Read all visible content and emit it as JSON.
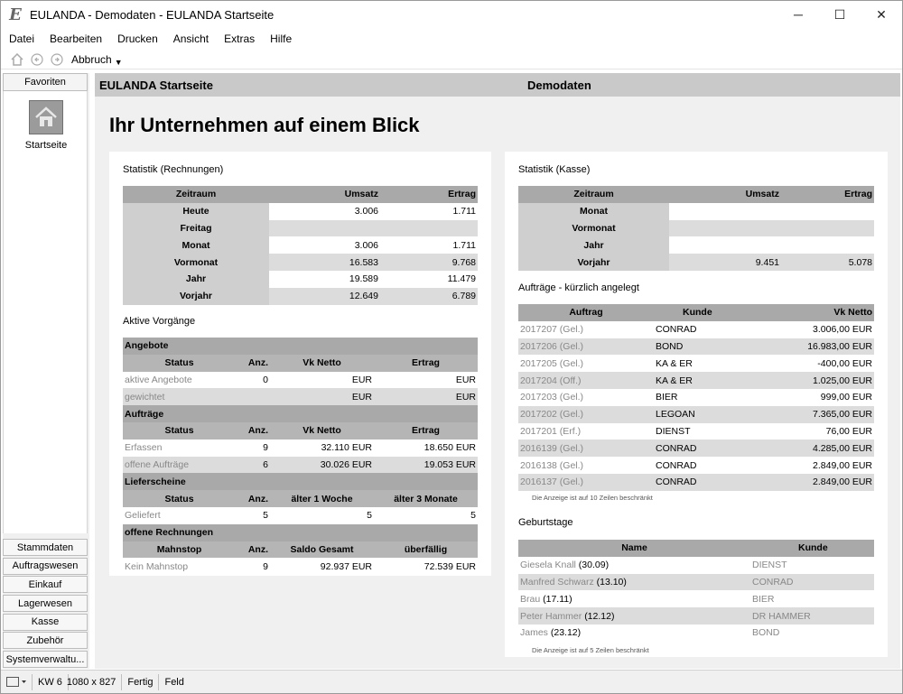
{
  "window": {
    "title": "EULANDA - Demodaten - EULANDA Startseite",
    "icon": "E",
    "controls": [
      "─",
      "☐",
      "✕"
    ]
  },
  "menu": [
    "Datei",
    "Bearbeiten",
    "Drucken",
    "Ansicht",
    "Extras",
    "Hilfe"
  ],
  "toolbar": {
    "abort_label": "Abbruch"
  },
  "sidebar": {
    "favorites_header": "Favoriten",
    "tile_label": "Startseite",
    "nav": [
      "Stammdaten",
      "Auftragswesen",
      "Einkauf",
      "Lagerwesen",
      "Kasse",
      "Zubehör",
      "Systemverwaltu..."
    ]
  },
  "main": {
    "header_left": "EULANDA Startseite",
    "header_center": "Demodaten",
    "headline": "Ihr Unternehmen auf einem Blick"
  },
  "stats_invoices": {
    "title": "Statistik (Rechnungen)",
    "columns": [
      "Zeitraum",
      "Umsatz",
      "Ertrag"
    ],
    "rows": [
      {
        "label": "Heute",
        "umsatz": "3.006",
        "ertrag": "1.711"
      },
      {
        "label": "Freitag",
        "umsatz": "",
        "ertrag": ""
      },
      {
        "label": "Monat",
        "umsatz": "3.006",
        "ertrag": "1.711"
      },
      {
        "label": "Vormonat",
        "umsatz": "16.583",
        "ertrag": "9.768"
      },
      {
        "label": "Jahr",
        "umsatz": "19.589",
        "ertrag": "11.479"
      },
      {
        "label": "Vorjahr",
        "umsatz": "12.649",
        "ertrag": "6.789"
      }
    ]
  },
  "active": {
    "title": "Aktive Vorgänge",
    "angebote": {
      "band": "Angebote",
      "columns": [
        "Status",
        "Anz.",
        "Vk Netto",
        "Ertrag"
      ],
      "rows": [
        {
          "status": "aktive Angebote",
          "anz": "0",
          "vk": "EUR",
          "ertrag": "EUR"
        },
        {
          "status": "gewichtet",
          "anz": "",
          "vk": "EUR",
          "ertrag": "EUR"
        }
      ]
    },
    "auftraege": {
      "band": "Aufträge",
      "columns": [
        "Status",
        "Anz.",
        "Vk Netto",
        "Ertrag"
      ],
      "rows": [
        {
          "status": "Erfassen",
          "anz": "9",
          "vk": "32.110 EUR",
          "ertrag": "18.650 EUR"
        },
        {
          "status": "offene Aufträge",
          "anz": "6",
          "vk": "30.026 EUR",
          "ertrag": "19.053 EUR"
        }
      ]
    },
    "lieferscheine": {
      "band": "Lieferscheine",
      "columns": [
        "Status",
        "Anz.",
        "älter 1 Woche",
        "älter 3 Monate"
      ],
      "rows": [
        {
          "status": "Geliefert",
          "anz": "5",
          "vk": "5",
          "ertrag": "5"
        }
      ]
    },
    "rechnungen": {
      "band": "offene Rechnungen",
      "columns": [
        "Mahnstop",
        "Anz.",
        "Saldo Gesamt",
        "überfällig"
      ],
      "rows": [
        {
          "status": "Kein Mahnstop",
          "anz": "9",
          "vk": "92.937 EUR",
          "ertrag": "72.539 EUR"
        }
      ]
    }
  },
  "stats_cash": {
    "title": "Statistik (Kasse)",
    "columns": [
      "Zeitraum",
      "Umsatz",
      "Ertrag"
    ],
    "rows": [
      {
        "label": "Monat",
        "umsatz": "",
        "ertrag": ""
      },
      {
        "label": "Vormonat",
        "umsatz": "",
        "ertrag": ""
      },
      {
        "label": "Jahr",
        "umsatz": "",
        "ertrag": ""
      },
      {
        "label": "Vorjahr",
        "umsatz": "9.451",
        "ertrag": "5.078"
      }
    ]
  },
  "orders": {
    "title": "Aufträge - kürzlich angelegt",
    "columns": [
      "Auftrag",
      "Kunde",
      "Vk Netto"
    ],
    "rows": [
      {
        "auftrag": "2017207 (Gel.)",
        "kunde": "CONRAD",
        "vk": "3.006,00 EUR"
      },
      {
        "auftrag": "2017206 (Gel.)",
        "kunde": "BOND",
        "vk": "16.983,00 EUR"
      },
      {
        "auftrag": "2017205 (Gel.)",
        "kunde": "KA & ER",
        "vk": "-400,00 EUR"
      },
      {
        "auftrag": "2017204 (Off.)",
        "kunde": "KA & ER",
        "vk": "1.025,00 EUR"
      },
      {
        "auftrag": "2017203 (Gel.)",
        "kunde": "BIER",
        "vk": "999,00 EUR"
      },
      {
        "auftrag": "2017202 (Gel.)",
        "kunde": "LEGOAN",
        "vk": "7.365,00 EUR"
      },
      {
        "auftrag": "2017201 (Erf.)",
        "kunde": "DIENST",
        "vk": "76,00 EUR"
      },
      {
        "auftrag": "2016139 (Gel.)",
        "kunde": "CONRAD",
        "vk": "4.285,00 EUR"
      },
      {
        "auftrag": "2016138 (Gel.)",
        "kunde": "CONRAD",
        "vk": "2.849,00 EUR"
      },
      {
        "auftrag": "2016137 (Gel.)",
        "kunde": "CONRAD",
        "vk": "2.849,00 EUR"
      }
    ],
    "note": "Die Anzeige ist auf 10 Zeilen beschränkt"
  },
  "birthdays": {
    "title": "Geburtstage",
    "columns": [
      "Name",
      "Kunde"
    ],
    "rows": [
      {
        "name": "Giesela Knall",
        "date": "(30.09)",
        "kunde": "DIENST"
      },
      {
        "name": "Manfred Schwarz",
        "date": "(13.10)",
        "kunde": "CONRAD"
      },
      {
        "name": "Brau",
        "date": "(17.11)",
        "kunde": "BIER"
      },
      {
        "name": "Peter Hammer",
        "date": "(12.12)",
        "kunde": "DR HAMMER"
      },
      {
        "name": "James",
        "date": "(23.12)",
        "kunde": "BOND"
      }
    ],
    "note": "Die Anzeige ist auf 5 Zeilen beschränkt"
  },
  "statusbar": {
    "week": "KW 6",
    "resolution": "1080 x 827",
    "state": "Fertig",
    "field": "Feld"
  }
}
